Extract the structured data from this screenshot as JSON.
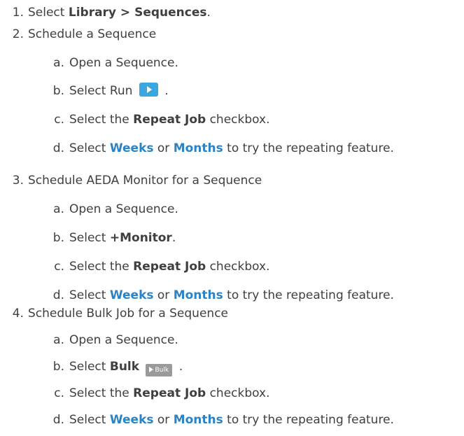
{
  "steps": [
    {
      "num": "1.",
      "pre": "Select ",
      "bold": "Library > Sequences",
      "post": "."
    },
    {
      "num": "2.",
      "text": "Schedule a Sequence",
      "sub": [
        {
          "letter": "a.",
          "text": "Open a Sequence."
        },
        {
          "letter": "b.",
          "pre": "Select Run",
          "post": ".",
          "icon": "run-play-icon"
        },
        {
          "letter": "c.",
          "pre": "Select the ",
          "bold": "Repeat Job",
          "post": " checkbox."
        },
        {
          "letter": "d.",
          "pre": "Select ",
          "link1": "Weeks",
          "mid": " or ",
          "link2": "Months",
          "post": " to try the repeating feature."
        }
      ]
    },
    {
      "num": "3.",
      "text": "Schedule AEDA Monitor for a Sequence",
      "sub": [
        {
          "letter": "a.",
          "text": "Open a Sequence."
        },
        {
          "letter": "b.",
          "pre": "Select ",
          "bold": "+Monitor",
          "post": "."
        },
        {
          "letter": "c.",
          "pre": "Select the ",
          "bold": "Repeat Job",
          "post": " checkbox."
        },
        {
          "letter": "d.",
          "pre": "Select ",
          "link1": "Weeks",
          "mid": " or ",
          "link2": "Months",
          "post": " to try the repeating feature."
        }
      ]
    },
    {
      "num": "4.",
      "text": "Schedule Bulk Job for a Sequence",
      "sub": [
        {
          "letter": "a.",
          "text": "Open a Sequence."
        },
        {
          "letter": "b.",
          "pre": "Select ",
          "bold": "Bulk",
          "post": ".",
          "icon": "bulk-button-icon",
          "icon_label": "Bulk"
        },
        {
          "letter": "c.",
          "pre": "Select the ",
          "bold": "Repeat Job",
          "post": " checkbox."
        },
        {
          "letter": "d.",
          "pre": "Select ",
          "link1": "Weeks",
          "mid": " or ",
          "link2": "Months",
          "post": " to try the repeating feature."
        }
      ]
    }
  ],
  "colors": {
    "text": "#3f3f3f",
    "link": "#2b82c4",
    "run_icon": "#3aa7e1",
    "bulk_icon": "#9a9a9a"
  }
}
